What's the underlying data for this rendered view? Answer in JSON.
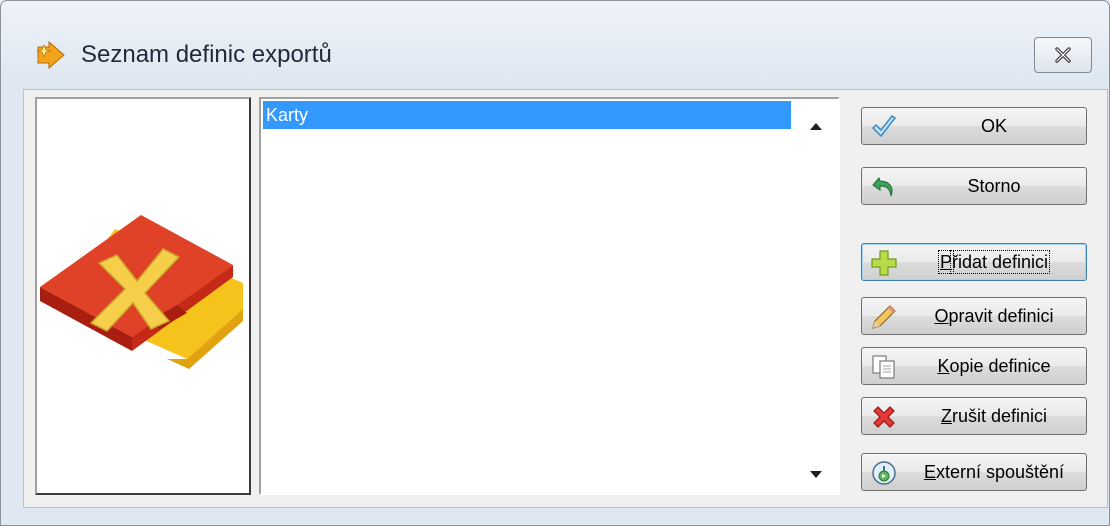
{
  "window": {
    "title": "Seznam definic exportů",
    "title_icon": "export-wand-icon",
    "close_icon": "close-icon"
  },
  "list": {
    "items": [
      "Karty"
    ],
    "selected_index": 0
  },
  "buttons": {
    "ok": "OK",
    "storno": "Storno",
    "pridat": {
      "accel": "P",
      "rest": "řidat definici"
    },
    "opravit": {
      "accel": "O",
      "rest": "pravit definici"
    },
    "kopie": {
      "accel": "K",
      "rest": "opie definice"
    },
    "zrusit": {
      "accel": "Z",
      "rest": "rušit definici"
    },
    "externi": {
      "accel": "E",
      "rest": "xterní spouštění"
    }
  },
  "colors": {
    "selection": "#3399ff",
    "logo_red": "#d8321e",
    "logo_yellow": "#f6c31c"
  }
}
